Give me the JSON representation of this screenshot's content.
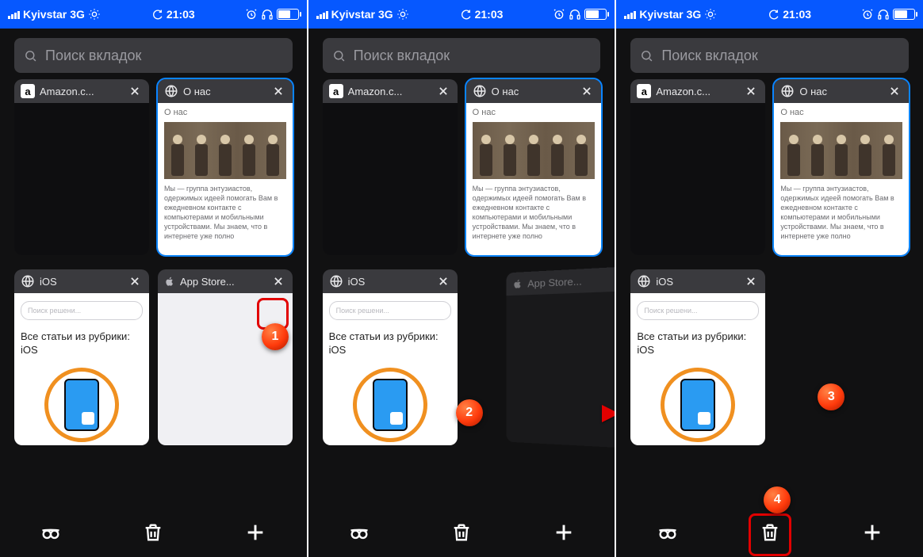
{
  "status": {
    "carrier": "Kyivstar",
    "net": "3G",
    "time": "21:03"
  },
  "search": {
    "placeholder": "Поиск вкладок"
  },
  "tabs": {
    "amazon": {
      "title": "Amazon.c...",
      "letter": "a"
    },
    "about": {
      "title": "О нас",
      "heading": "О нас",
      "desc": "Мы — группа энтузиастов, одержимых идеей помогать Вам в ежедневном контакте с компьютерами и мобильными устройствами. Мы знаем, что в интернете уже полно"
    },
    "ios": {
      "title": "iOS",
      "search_ph": "Поиск решени...",
      "heading": "Все статьи из рубрики: iOS"
    },
    "appstore": {
      "title": "App Store..."
    }
  },
  "markers": {
    "m1": "1",
    "m2": "2",
    "m3": "3",
    "m4": "4"
  }
}
